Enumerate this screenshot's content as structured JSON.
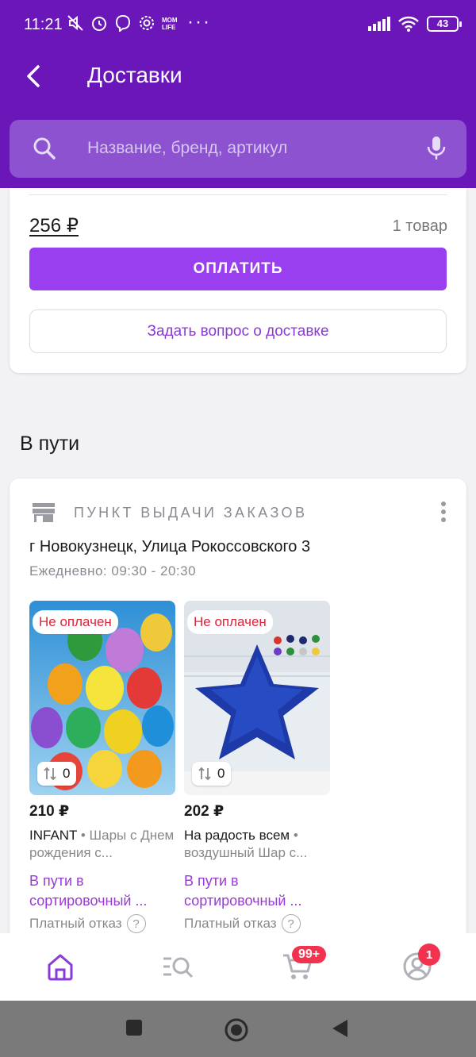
{
  "status_bar": {
    "time": "11:21",
    "battery": "43",
    "icons": [
      "mute-icon",
      "alarm-icon",
      "viber-icon",
      "settings-icon",
      "mom-life-icon",
      "more-dots",
      "signal-icon",
      "wifi-icon",
      "battery-icon"
    ],
    "app_label": "MOM LIFE"
  },
  "header": {
    "title": "Доставки",
    "search_placeholder": "Название, бренд, артикул"
  },
  "payment": {
    "total": "256 ₽",
    "item_count": "1 товар",
    "pay_label": "ОПЛАТИТЬ",
    "ask_label": "Задать вопрос о доставке"
  },
  "in_transit": {
    "title": "В пути",
    "pickup_label": "ПУНКТ ВЫДАЧИ ЗАКАЗОВ",
    "address": "г Новокузнецк, Улица Рокоссовского 3",
    "hours": "Ежедневно: 09:30 - 20:30",
    "products": [
      {
        "badge": "Не оплачен",
        "compare_count": "0",
        "price": "210 ₽",
        "brand": "INFANT",
        "name": " • Шары с Днем рождения с...",
        "status": "В пути в сортировочный ...",
        "refund": "Платный отказ"
      },
      {
        "badge": "Не оплачен",
        "compare_count": "0",
        "price": "202 ₽",
        "brand": "На радость всем",
        "name": " • воздушный Шар с...",
        "status": "В пути в сортировочный ...",
        "refund": "Платный отказ"
      }
    ]
  },
  "tab_bar": {
    "cart_badge": "99+",
    "profile_badge": "1"
  },
  "colors": {
    "brand_purple": "#6a16b8",
    "accent_purple": "#9a3ff0",
    "badge_red": "#f2324e"
  }
}
